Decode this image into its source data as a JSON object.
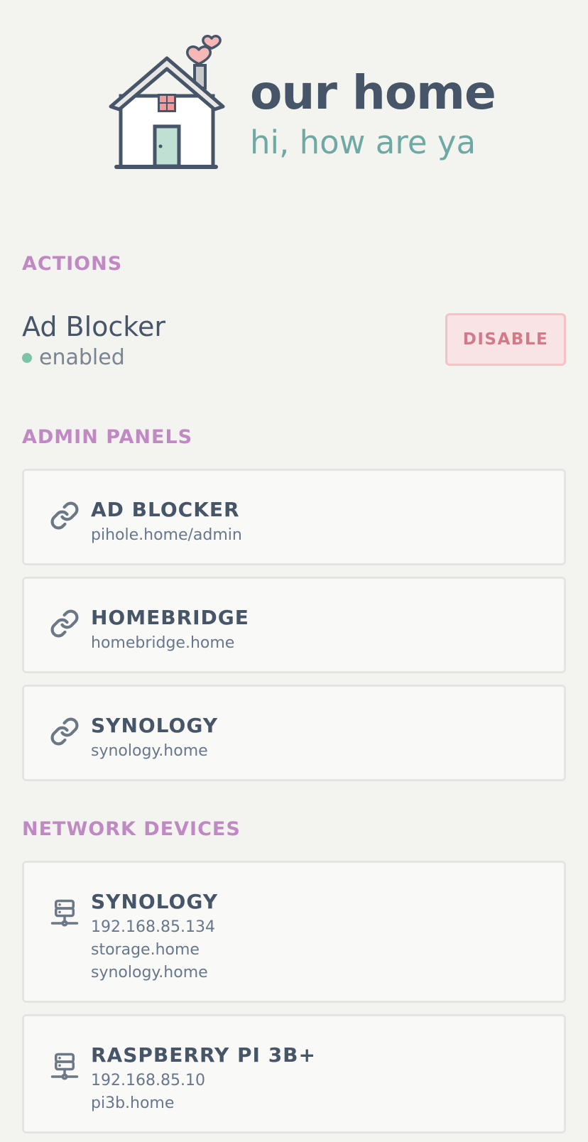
{
  "brand": {
    "title": "our home",
    "subtitle": "hi, how are ya"
  },
  "sections": {
    "actions": "ACTIONS",
    "admin_panels": "ADMIN PANELS",
    "network_devices": "NETWORK DEVICES"
  },
  "actions": {
    "ad_blocker": {
      "name": "Ad Blocker",
      "status": "enabled",
      "button_label": "DISABLE"
    }
  },
  "admin_panels": [
    {
      "title": "AD BLOCKER",
      "url": "pihole.home/admin",
      "icon": "link-icon"
    },
    {
      "title": "HOMEBRIDGE",
      "url": "homebridge.home",
      "icon": "link-icon"
    },
    {
      "title": "SYNOLOGY",
      "url": "synology.home",
      "icon": "link-icon"
    }
  ],
  "network_devices": [
    {
      "title": "SYNOLOGY",
      "lines": [
        "192.168.85.134",
        "storage.home",
        "synology.home"
      ],
      "icon": "server-icon"
    },
    {
      "title": "RASPBERRY PI 3B+",
      "lines": [
        "192.168.85.10",
        "pi3b.home"
      ],
      "icon": "server-icon"
    }
  ],
  "colors": {
    "background": "#f3f3f0",
    "accent_label": "#c089c4",
    "text_dark": "#465567",
    "teal": "#6fa9a3",
    "status_green": "#7cc3a8",
    "danger_bg": "#f8e4e4",
    "danger_text": "#d37a8a"
  }
}
